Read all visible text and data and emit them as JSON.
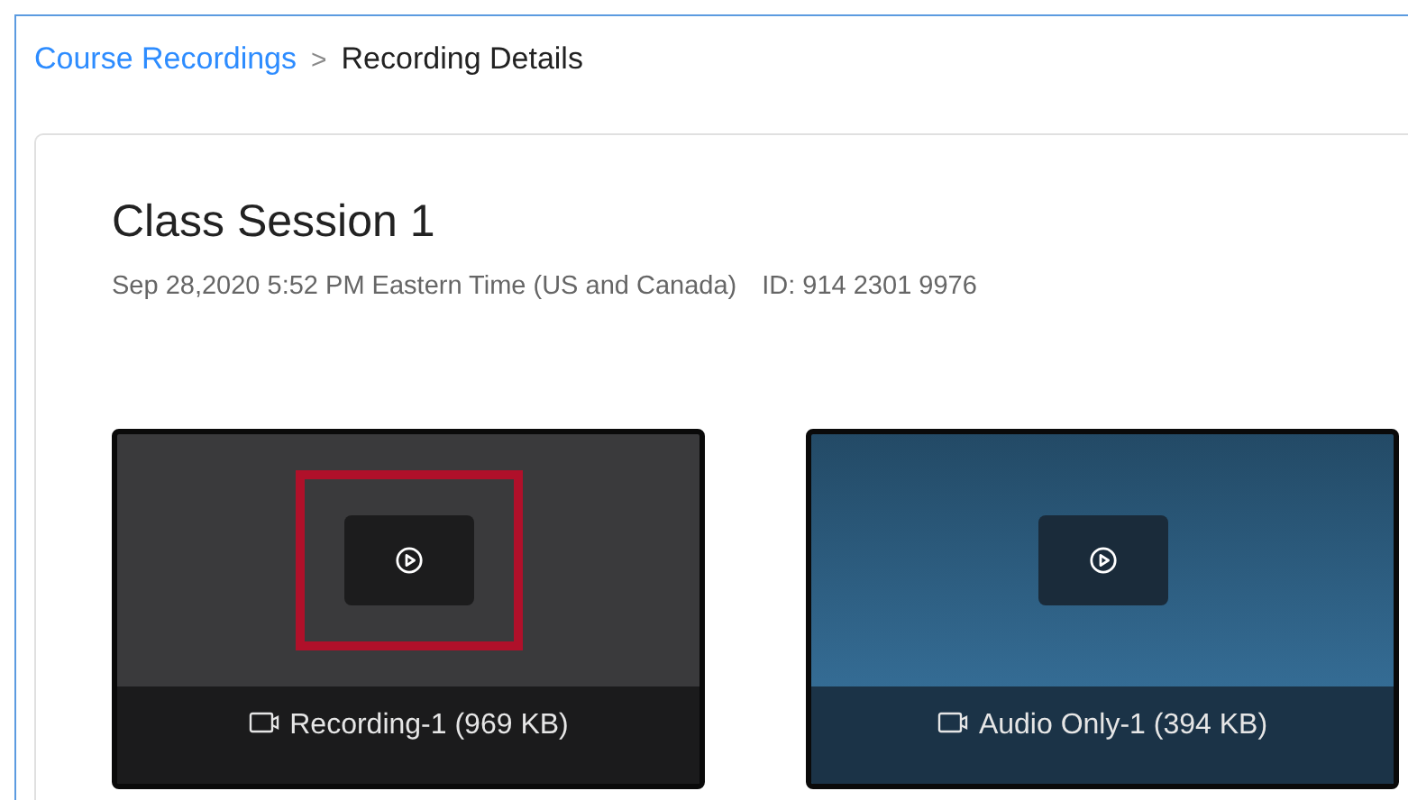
{
  "breadcrumb": {
    "link": "Course Recordings",
    "separator": ">",
    "current": "Recording Details"
  },
  "recording": {
    "title": "Class Session 1",
    "date": "Sep 28,2020 5:52 PM Eastern Time (US and Canada)",
    "id": "ID: 914 2301 9976"
  },
  "files": [
    {
      "kind": "video",
      "label": "Recording-1 (969 KB)",
      "highlighted": true
    },
    {
      "kind": "audio",
      "label": "Audio Only-1 (394 KB)",
      "highlighted": false
    }
  ]
}
